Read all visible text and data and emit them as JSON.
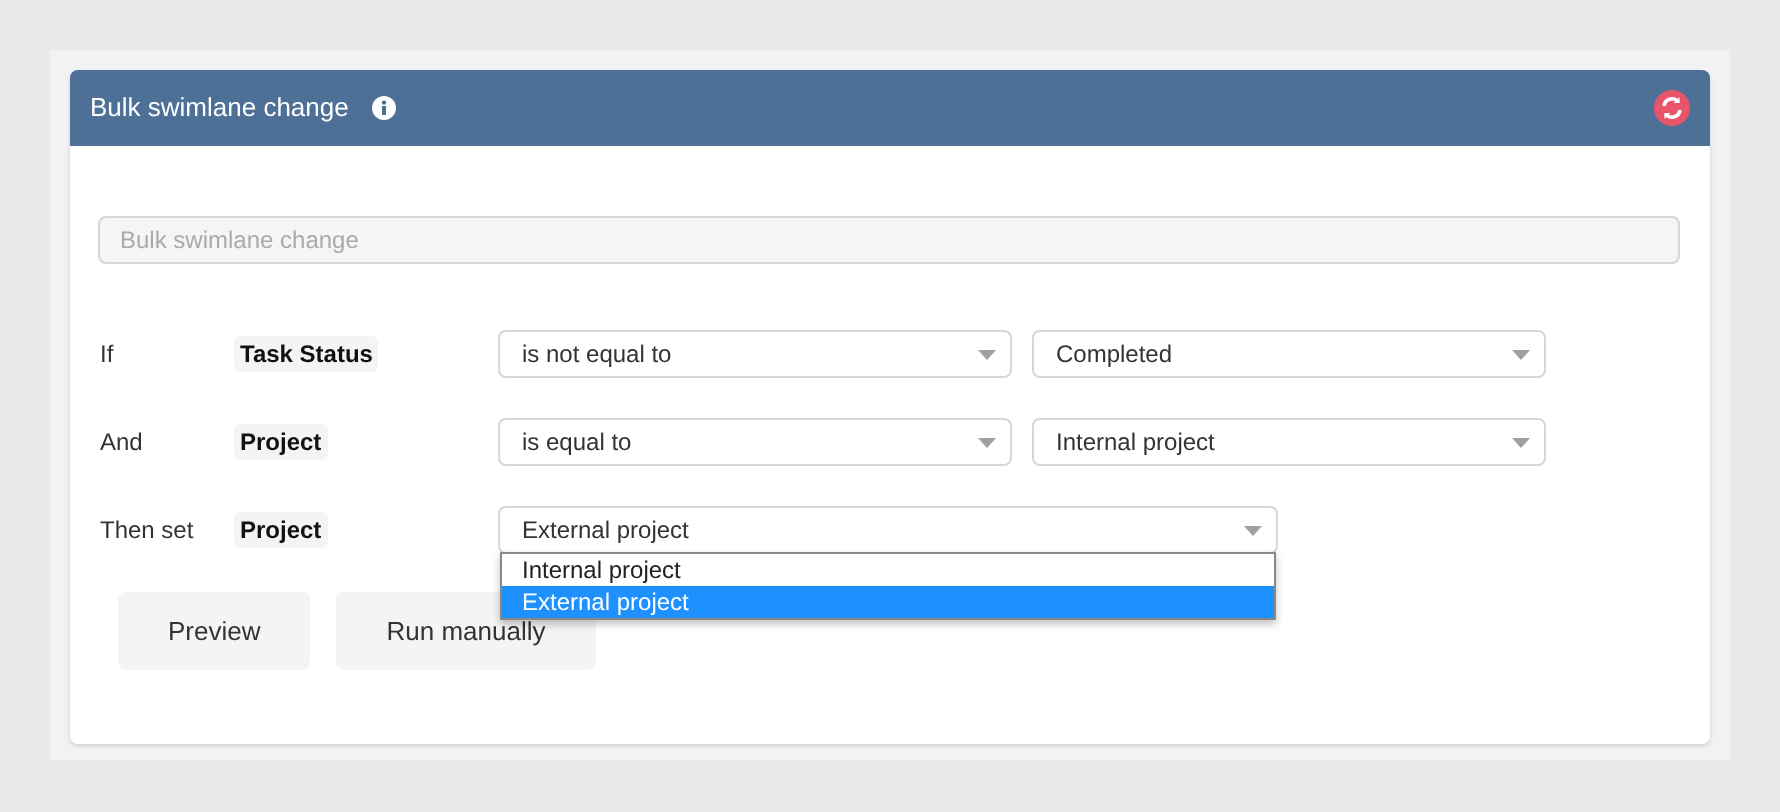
{
  "panel": {
    "title": "Bulk swimlane change"
  },
  "name_field": {
    "placeholder": "Bulk swimlane change"
  },
  "rules": [
    {
      "kind": "condition",
      "label": "If",
      "field": "Task Status",
      "operator": "is not equal to",
      "value": "Completed"
    },
    {
      "kind": "condition",
      "label": "And",
      "field": "Project",
      "operator": "is equal to",
      "value": "Internal project"
    },
    {
      "kind": "action",
      "label": "Then set",
      "field": "Project",
      "value": "External project",
      "expanded": true,
      "options": [
        {
          "label": "Internal project",
          "selected": false
        },
        {
          "label": "External project",
          "selected": true
        }
      ]
    }
  ],
  "buttons": [
    "Preview",
    "Run manually"
  ]
}
